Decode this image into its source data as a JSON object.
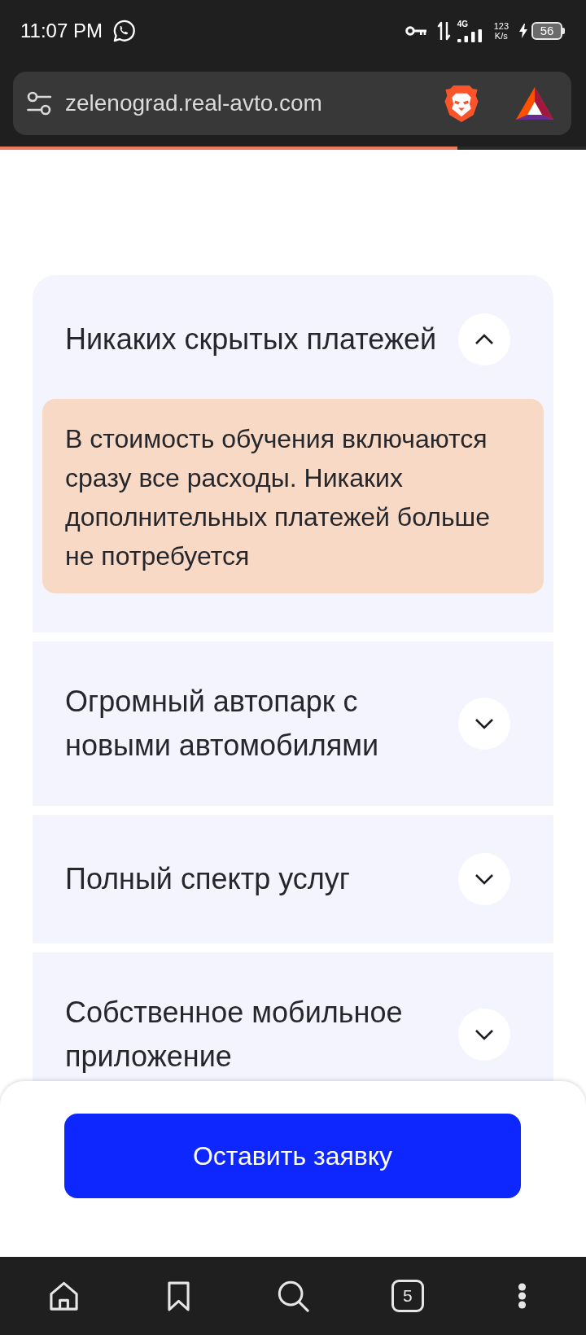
{
  "status_bar": {
    "time": "11:07 PM",
    "network_type": "4G",
    "speed_value": "123",
    "speed_unit": "K/s",
    "battery": "56"
  },
  "browser": {
    "url": "zelenograd.real-avto.com",
    "page_load": {
      "level": 0.78
    }
  },
  "faq": [
    {
      "question": "Никаких скрытых платежей",
      "expanded": true,
      "answer": "В стоимость обучения включаются сразу все расходы. Никаких дополнительных платежей больше не потребуется"
    },
    {
      "question": "Огромный автопарк с новыми автомобилями",
      "expanded": false
    },
    {
      "question": "Полный спектр услуг",
      "expanded": false
    },
    {
      "question": "Собственное мобильное приложение",
      "expanded": false
    }
  ],
  "cta_button": "Оставить заявку",
  "bottom_nav": {
    "tab_count": "5"
  }
}
